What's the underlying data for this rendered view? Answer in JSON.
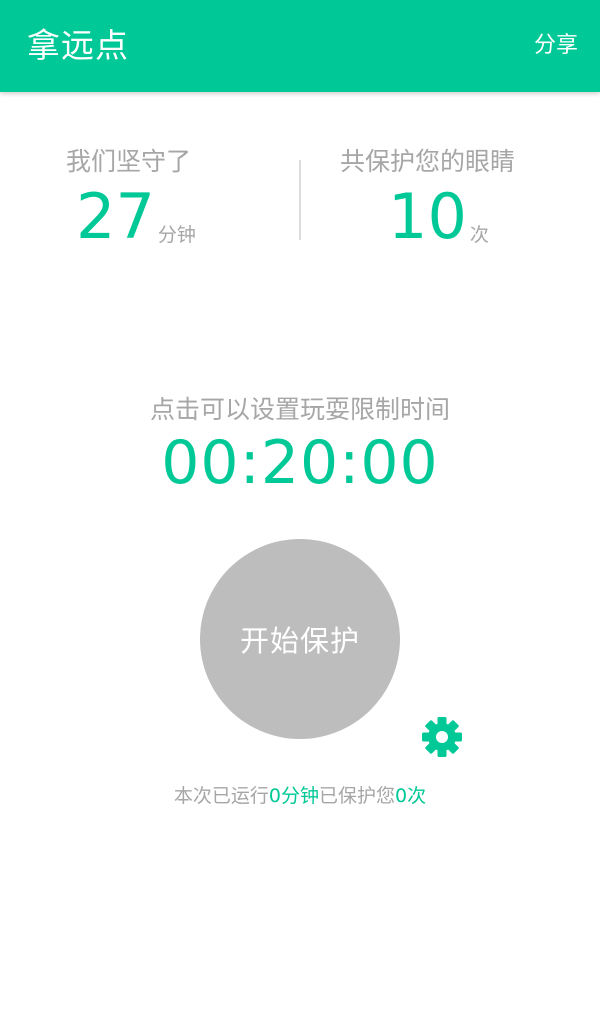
{
  "colors": {
    "accent": "#00c896",
    "button_gray": "#bdbdbd",
    "text_gray": "#a6a6a6"
  },
  "app_bar": {
    "title": "拿远点",
    "share_label": "分享"
  },
  "stats": {
    "left": {
      "label": "我们坚守了",
      "value": "27",
      "unit": "分钟"
    },
    "right": {
      "label": "共保护您的眼睛",
      "value": "10",
      "unit": "次"
    }
  },
  "timer": {
    "hint": "点击可以设置玩耍限制时间",
    "value": "00:20:00"
  },
  "start_button": {
    "label": "开始保护"
  },
  "settings": {
    "icon": "gear-icon"
  },
  "summary": {
    "prefix": "本次已运行",
    "minutes": "0分钟",
    "middle": "已保护您",
    "count": "0次"
  }
}
